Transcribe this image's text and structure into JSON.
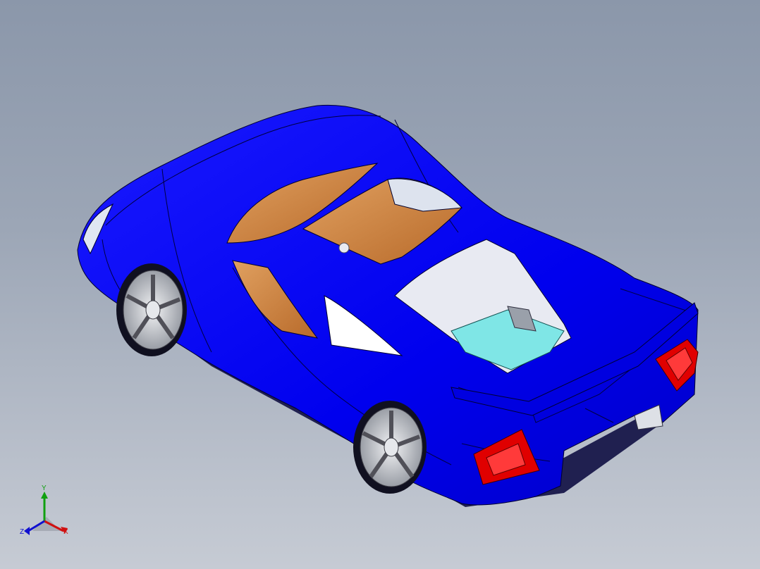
{
  "viewport": {
    "background_top": "#8b97aa",
    "background_bottom": "#c6cbd4"
  },
  "model": {
    "body_color": "#0000f0",
    "glass_color": "#ffffff",
    "taillight_color": "#e00000",
    "interior_color": "#d88a3a",
    "seat_color": "#7fe6e6",
    "rim_color": "#d4d6da"
  },
  "triad": {
    "x_label": "X",
    "y_label": "Y",
    "z_label": "Z",
    "x_color": "#d01010",
    "y_color": "#10a010",
    "z_color": "#1010d0"
  }
}
